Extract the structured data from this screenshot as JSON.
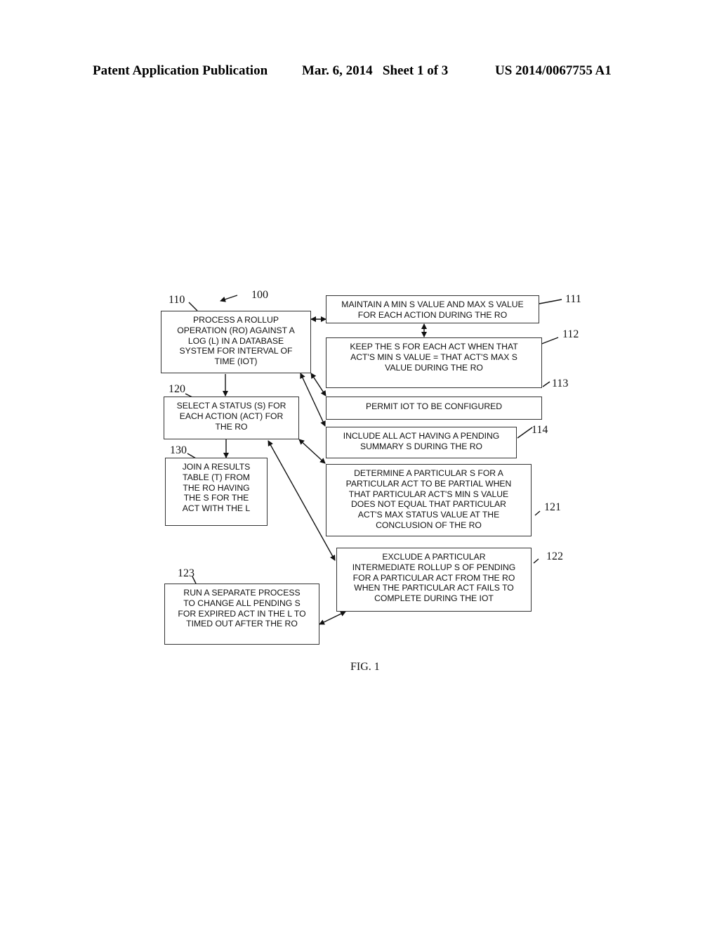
{
  "header": {
    "publication": "Patent Application Publication",
    "date_sheet": "Mar. 6, 2014   Sheet 1 of 3",
    "number": "US 2014/0067755 A1"
  },
  "diagram": {
    "figure_ref": "100",
    "caption": "FIG. 1",
    "boxes": {
      "b110": {
        "ref": "110",
        "text": "PROCESS A ROLLUP\nOPERATION (RO) AGAINST A\nLOG (L) IN A DATABASE\nSYSTEM FOR INTERVAL OF\nTIME (IOT)"
      },
      "b120": {
        "ref": "120",
        "text": "SELECT A STATUS (S) FOR\nEACH ACTION (ACT) FOR\nTHE RO"
      },
      "b130": {
        "ref": "130",
        "text": "JOIN A RESULTS\nTABLE (T) FROM\nTHE RO HAVING\nTHE S FOR THE\nACT WITH THE L"
      },
      "b111": {
        "ref": "111",
        "text": "MAINTAIN A MIN S VALUE AND MAX S VALUE\nFOR EACH ACTION DURING THE RO"
      },
      "b112": {
        "ref": "112",
        "text": "KEEP THE S FOR EACH ACT WHEN THAT\nACT'S MIN S VALUE = THAT ACT'S MAX S\nVALUE DURING THE RO"
      },
      "b113": {
        "ref": "113",
        "text": "PERMIT IOT TO BE CONFIGURED"
      },
      "b114": {
        "ref": "114",
        "text": "INCLUDE ALL ACT HAVING A PENDING\nSUMMARY S DURING THE RO"
      },
      "b121": {
        "ref": "121",
        "text": "DETERMINE A PARTICULAR S FOR A\nPARTICULAR ACT TO BE PARTIAL WHEN\nTHAT PARTICULAR ACT'S MIN S VALUE\nDOES NOT EQUAL THAT PARTICULAR\nACT'S MAX STATUS VALUE AT THE\nCONCLUSION OF THE RO"
      },
      "b122": {
        "ref": "122",
        "text": "EXCLUDE A PARTICULAR\nINTERMEDIATE ROLLUP S OF PENDING\nFOR A PARTICULAR ACT FROM THE RO\nWHEN THE PARTICULAR ACT FAILS TO\nCOMPLETE DURING THE IOT"
      },
      "b123": {
        "ref": "123",
        "text": "RUN A SEPARATE PROCESS\nTO CHANGE ALL PENDING S\nFOR EXPIRED ACT IN THE L TO\nTIMED OUT AFTER THE RO"
      }
    }
  }
}
